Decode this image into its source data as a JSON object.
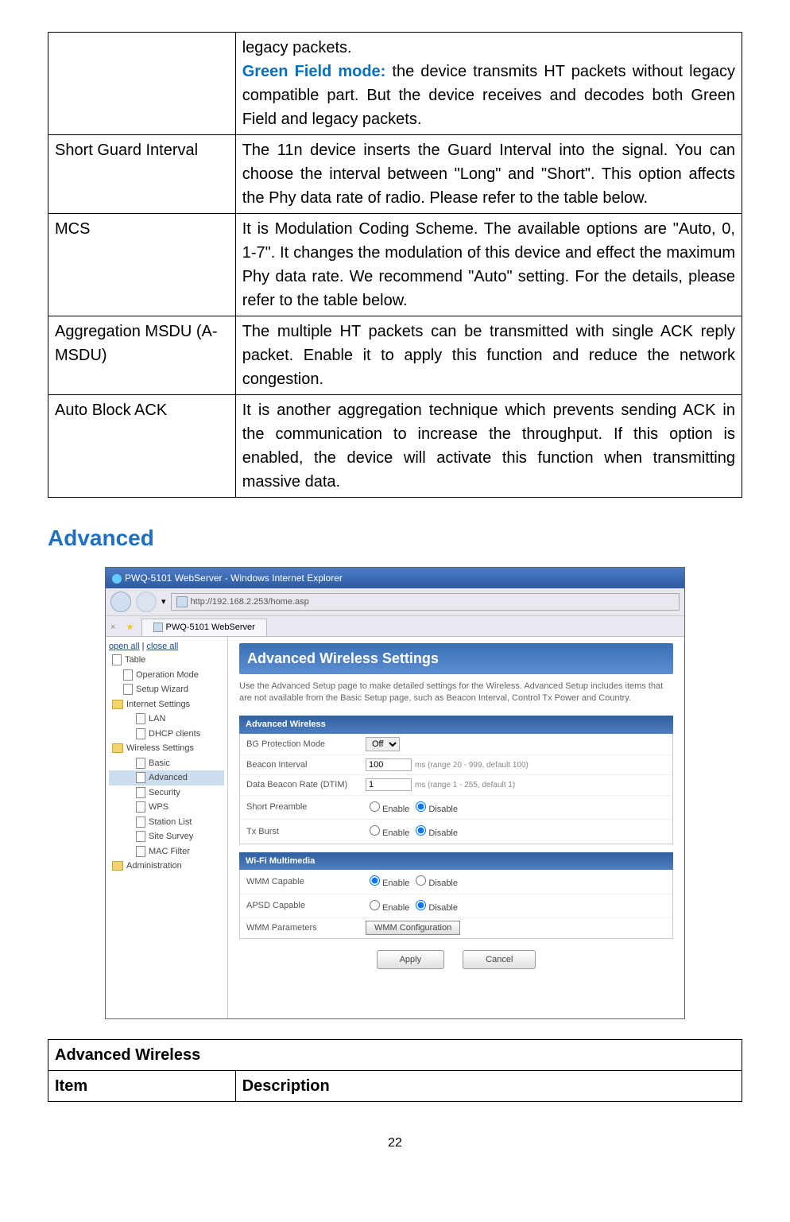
{
  "table1": {
    "rows": [
      {
        "label": "",
        "desc_pre": "legacy packets.",
        "emph": "Green Field mode:",
        "desc_post": " the device transmits HT packets without legacy compatible part. But the device receives and decodes both Green Field and legacy packets."
      },
      {
        "label": "Short Guard Interval",
        "desc": "The 11n device inserts the Guard Interval into the signal. You can choose the interval between \"Long\" and \"Short\". This option affects the Phy data rate of radio. Please refer to the table below."
      },
      {
        "label": "MCS",
        "desc": "It is Modulation Coding Scheme. The available options are \"Auto, 0, 1-7\". It changes the modulation of this device and effect the maximum Phy data rate. We recommend \"Auto\" setting. For the details, please refer to the table below."
      },
      {
        "label": "Aggregation MSDU (A-MSDU)",
        "desc": "The multiple HT packets can be transmitted with single ACK reply packet. Enable it to apply this function and reduce the network congestion."
      },
      {
        "label": "Auto Block ACK",
        "desc": "It is another aggregation technique which prevents sending ACK in the communication to increase the throughput. If this option is enabled, the device will activate this function when transmitting massive data."
      }
    ]
  },
  "section_heading": "Advanced",
  "browser": {
    "title": "PWQ-5101 WebServer - Windows Internet Explorer",
    "url": "http://192.168.2.253/home.asp",
    "tab": "PWQ-5101 WebServer"
  },
  "sidebar": {
    "open_all": "open all",
    "close_all": "close all",
    "items": [
      {
        "label": "Table",
        "cls": "doc"
      },
      {
        "label": "Operation Mode",
        "cls": "doc indent1"
      },
      {
        "label": "Setup Wizard",
        "cls": "doc indent1"
      },
      {
        "label": "Internet Settings",
        "cls": "folder"
      },
      {
        "label": "LAN",
        "cls": "doc indent2"
      },
      {
        "label": "DHCP clients",
        "cls": "doc indent2"
      },
      {
        "label": "Wireless Settings",
        "cls": "folder"
      },
      {
        "label": "Basic",
        "cls": "doc indent2"
      },
      {
        "label": "Advanced",
        "cls": "doc indent2 selected"
      },
      {
        "label": "Security",
        "cls": "doc indent2"
      },
      {
        "label": "WPS",
        "cls": "doc indent2"
      },
      {
        "label": "Station List",
        "cls": "doc indent2"
      },
      {
        "label": "Site Survey",
        "cls": "doc indent2"
      },
      {
        "label": "MAC Filter",
        "cls": "doc indent2"
      },
      {
        "label": "Administration",
        "cls": "folder"
      }
    ]
  },
  "main": {
    "banner": "Advanced Wireless Settings",
    "intro": "Use the Advanced Setup page to make detailed settings for the Wireless. Advanced Setup includes items that are not available from the Basic Setup page, such as Beacon Interval, Control Tx Power and Country.",
    "panel1": {
      "title": "Advanced Wireless",
      "rows": [
        {
          "label": "BG Protection Mode",
          "type": "select",
          "value": "Off"
        },
        {
          "label": "Beacon Interval",
          "type": "text",
          "value": "100",
          "hint": "ms (range 20 - 999, default 100)"
        },
        {
          "label": "Data Beacon Rate (DTIM)",
          "type": "text",
          "value": "1",
          "hint": "ms (range 1 - 255, default 1)"
        },
        {
          "label": "Short Preamble",
          "type": "radio",
          "enable": "Enable",
          "disable": "Disable",
          "checked": "disable"
        },
        {
          "label": "Tx Burst",
          "type": "radio",
          "enable": "Enable",
          "disable": "Disable",
          "checked": "disable"
        }
      ]
    },
    "panel2": {
      "title": "Wi-Fi Multimedia",
      "rows": [
        {
          "label": "WMM Capable",
          "type": "radio",
          "enable": "Enable",
          "disable": "Disable",
          "checked": "enable"
        },
        {
          "label": "APSD Capable",
          "type": "radio",
          "enable": "Enable",
          "disable": "Disable",
          "checked": "disable"
        },
        {
          "label": "WMM Parameters",
          "type": "button",
          "btn": "WMM Configuration"
        }
      ]
    },
    "apply": "Apply",
    "cancel": "Cancel"
  },
  "table2": {
    "header": "Advanced Wireless",
    "col1": "Item",
    "col2": "Description"
  },
  "page_number": "22"
}
